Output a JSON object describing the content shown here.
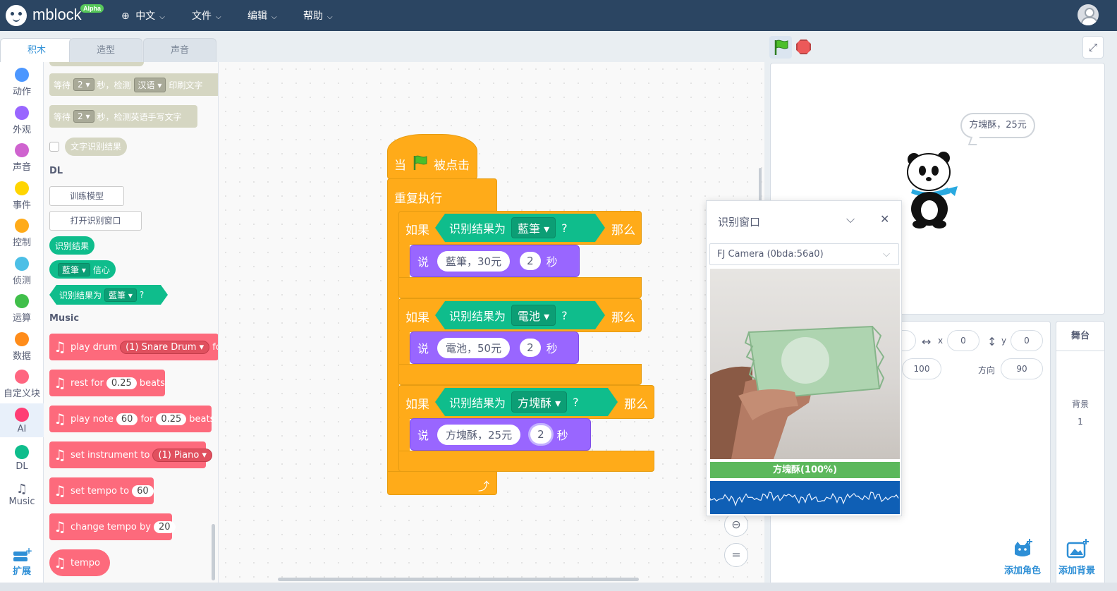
{
  "header": {
    "logo_text": "mblock",
    "badge": "Alpha",
    "menus": [
      {
        "label": "中文",
        "icon": "globe-icon"
      },
      {
        "label": "文件"
      },
      {
        "label": "编辑"
      },
      {
        "label": "帮助"
      }
    ]
  },
  "tabs": [
    "积木",
    "造型",
    "声音"
  ],
  "categories": [
    {
      "label": "动作",
      "color": "#4c97ff"
    },
    {
      "label": "外观",
      "color": "#9966ff"
    },
    {
      "label": "声音",
      "color": "#cf63cf"
    },
    {
      "label": "事件",
      "color": "#ffd500"
    },
    {
      "label": "控制",
      "color": "#ffab19"
    },
    {
      "label": "侦测",
      "color": "#4cbfe6"
    },
    {
      "label": "运算",
      "color": "#40bf4a"
    },
    {
      "label": "数据",
      "color": "#ff8c1a"
    },
    {
      "label": "自定义块",
      "color": "#ff6680"
    },
    {
      "label": "AI",
      "color": "#ff3d74"
    },
    {
      "label": "DL",
      "color": "#0fbd8c"
    },
    {
      "label": "Music",
      "icon": "music-note-icon"
    },
    {
      "label": "扩展",
      "icon": "extension-icon"
    }
  ],
  "palette": {
    "wait_blocks": [
      {
        "pre": "等待",
        "num": "2",
        "mid": "秒，检测",
        "drop": "汉语",
        "post": "印刷文字"
      },
      {
        "pre": "等待",
        "num": "2",
        "mid": "秒，检测英语手写文字"
      }
    ],
    "text_result": "文字识别结果",
    "dl_label": "DL",
    "dl_buttons": [
      "训练模型",
      "打开识别窗口"
    ],
    "dl_result": "识别结果",
    "dl_conf_drop": "藍筆",
    "dl_conf_label": "信心",
    "dl_is_label": "识别结果为",
    "dl_is_drop": "藍筆",
    "dl_is_q": "?",
    "music_label": "Music",
    "music_blocks": [
      {
        "text": "play drum",
        "drop": "(1) Snare Drum",
        "tail": "for"
      },
      {
        "text": "rest for",
        "num": "0.25",
        "tail": "beats"
      },
      {
        "text": "play note",
        "num": "60",
        "mid": "for",
        "num2": "0.25",
        "tail": "beats"
      },
      {
        "text": "set instrument to",
        "drop": "(1) Piano"
      },
      {
        "text": "set tempo to",
        "num": "60"
      },
      {
        "text": "change tempo by",
        "num": "20"
      },
      {
        "text": "tempo"
      }
    ]
  },
  "script": {
    "hat_pre": "当",
    "hat_post": "被点击",
    "repeat": "重复执行",
    "ifs": [
      {
        "if": "如果",
        "cond": "识别结果为",
        "drop": "藍筆",
        "q": "?",
        "then": "那么",
        "say": "说",
        "text": "藍筆，30元",
        "secs": "2",
        "unit": "秒"
      },
      {
        "if": "如果",
        "cond": "识别结果为",
        "drop": "電池",
        "q": "?",
        "then": "那么",
        "say": "说",
        "text": "電池，50元",
        "secs": "2",
        "unit": "秒"
      },
      {
        "if": "如果",
        "cond": "识别结果为",
        "drop": "方塊酥",
        "q": "?",
        "then": "那么",
        "say": "说",
        "text": "方塊酥，25元",
        "secs": "2",
        "unit": "秒"
      }
    ]
  },
  "stage": {
    "bubble": "方塊酥，25元"
  },
  "sprite": {
    "x_label": "x",
    "x": "0",
    "y_label": "y",
    "y": "0",
    "size": "100",
    "dir_label": "方向",
    "dir": "90",
    "add_sprite": "添加角色"
  },
  "stage_panel": {
    "title": "舞台",
    "bg_label": "背景",
    "bg_count": "1",
    "add_bg": "添加背景"
  },
  "recognition": {
    "title": "识别窗口",
    "camera": "FJ Camera (0bda:56a0)",
    "result": "方塊酥(100%)",
    "result_fraction": 1.0
  }
}
